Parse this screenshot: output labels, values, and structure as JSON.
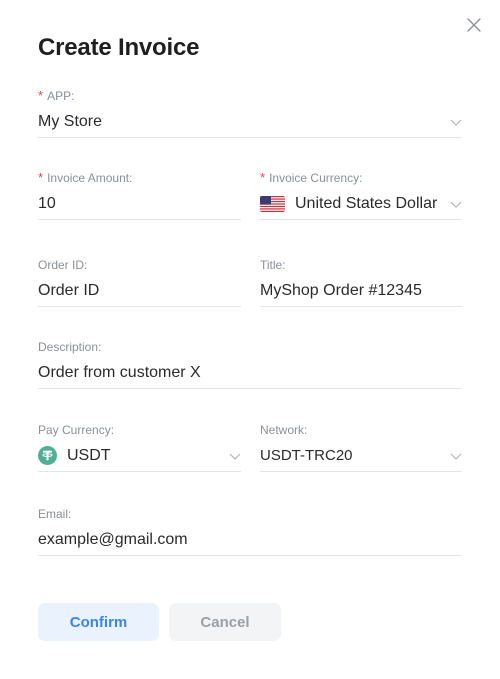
{
  "dialog": {
    "title": "Create Invoice",
    "close_icon": "close-icon"
  },
  "form": {
    "app": {
      "label": "APP",
      "required": true,
      "value": "My Store"
    },
    "invoice_amount": {
      "label": "Invoice Amount",
      "required": true,
      "value": "10"
    },
    "invoice_currency": {
      "label": "Invoice Currency",
      "required": true,
      "value": "United States Dollar",
      "icon": "us-flag-icon"
    },
    "order_id": {
      "label": "Order ID",
      "placeholder": "Order ID"
    },
    "title": {
      "label": "Title",
      "value": "MyShop Order #12345"
    },
    "description": {
      "label": "Description",
      "value": "Order from customer X"
    },
    "pay_currency": {
      "label": "Pay Currency",
      "value": "USDT",
      "icon": "tether-icon"
    },
    "network": {
      "label": "Network",
      "value": "USDT-TRC20"
    },
    "email": {
      "label": "Email",
      "value": "example@gmail.com"
    }
  },
  "actions": {
    "confirm": "Confirm",
    "cancel": "Cancel"
  },
  "colors": {
    "required_marker": "#e5484d",
    "primary": "#3a86e0",
    "tether_green": "#50af95"
  }
}
